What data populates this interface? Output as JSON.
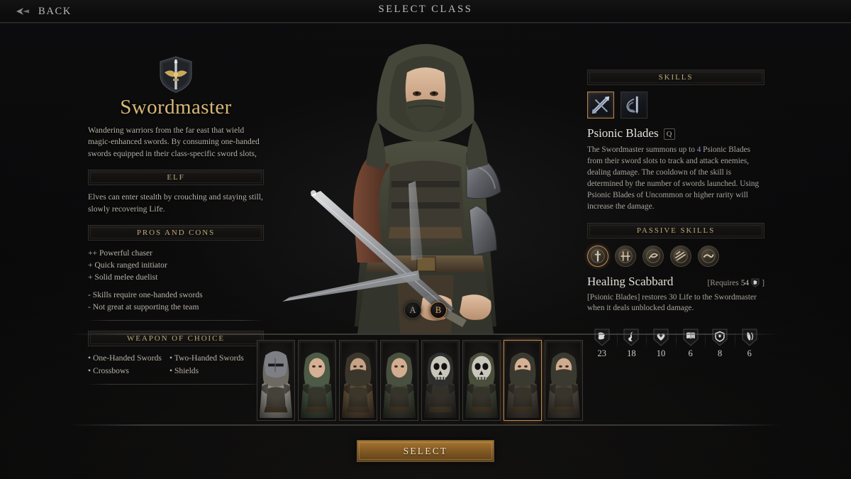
{
  "topbar": {
    "back_label": "BACK",
    "back_icon": "back-arrow-icon",
    "title": "SELECT CLASS"
  },
  "left_panel": {
    "crest_icon": "class-crest-shield-sword-icon",
    "class_name": "Swordmaster",
    "class_description": "Wandering warriors from the far east that wield magic-enhanced swords. By consuming one-handed swords equipped in their class-specific sword slots,",
    "race_section": {
      "header": "ELF",
      "description": "Elves can enter stealth by crouching and staying still, slowly recovering Life."
    },
    "pros_cons_section": {
      "header": "PROS AND CONS",
      "pros": [
        "++ Powerful chaser",
        "+ Quick ranged initiator",
        "+ Solid melee duelist"
      ],
      "cons": [
        "- Skills require one-handed swords",
        "- Not great at supporting the team"
      ]
    },
    "weapon_section": {
      "header": "WEAPON OF CHOICE",
      "items": [
        "• One-Handed Swords",
        "• Two-Handed Swords",
        "• Crossbows",
        "• Shields"
      ]
    }
  },
  "character": {
    "variants": [
      {
        "label": "A",
        "selected": false
      },
      {
        "label": "B",
        "selected": true
      }
    ]
  },
  "right_panel": {
    "skills_section": {
      "header": "SKILLS",
      "icons": [
        {
          "name": "psionic-blades-skill-icon",
          "selected": true
        },
        {
          "name": "sword-dance-skill-icon",
          "selected": false
        }
      ],
      "selected_skill": {
        "name": "Psionic Blades",
        "hotkey": "Q",
        "description_part1": "The Swordmaster summons up to ",
        "highlight": "4",
        "description_part2": " Psionic Blades from their sword slots to track and attack enemies, dealing damage. The cooldown of the skill is determined by the number of swords launched. Using Psionic Blades of Uncommon or higher rarity will increase the damage."
      }
    },
    "passive_section": {
      "header": "PASSIVE SKILLS",
      "icons": [
        {
          "name": "healing-scabbard-passive-icon",
          "selected": true
        },
        {
          "name": "passive-icon-2",
          "selected": false
        },
        {
          "name": "passive-icon-3",
          "selected": false
        },
        {
          "name": "passive-icon-4",
          "selected": false
        },
        {
          "name": "passive-icon-5",
          "selected": false
        }
      ],
      "selected_passive": {
        "name": "Healing Scabbard",
        "requires_prefix": "[Requires",
        "requires_value": "54",
        "requires_icon": "strength-icon",
        "requires_suffix": "]",
        "description": "[Psionic Blades] restores 30 Life to the Swordmaster when it deals unblocked damage."
      }
    },
    "stats": [
      {
        "icon": "strength-stat-icon",
        "value": "23"
      },
      {
        "icon": "agility-stat-icon",
        "value": "18"
      },
      {
        "icon": "vitality-stat-icon",
        "value": "10"
      },
      {
        "icon": "knowledge-stat-icon",
        "value": "6"
      },
      {
        "icon": "resourcefulness-stat-icon",
        "value": "8"
      },
      {
        "icon": "dexterity-stat-icon",
        "value": "6"
      }
    ]
  },
  "portraits": [
    {
      "name": "portrait-fighter",
      "selected": false,
      "hood": "#6c6a63",
      "cloth": "#8c8a83",
      "skin": "#c9a98e",
      "masked": false,
      "skull": false,
      "helm": true
    },
    {
      "name": "portrait-ranger",
      "selected": false,
      "hood": "#4d5b46",
      "cloth": "#3f4c3b",
      "skin": "#d6b094",
      "masked": false,
      "skull": false,
      "helm": false
    },
    {
      "name": "portrait-rogue",
      "selected": false,
      "hood": "#3b362c",
      "cloth": "#5a4a35",
      "skin": "#c6a286",
      "masked": true,
      "skull": false,
      "helm": false
    },
    {
      "name": "portrait-cleric",
      "selected": false,
      "hood": "#49503f",
      "cloth": "#3d4335",
      "skin": "#d2ad90",
      "masked": false,
      "skull": false,
      "helm": false
    },
    {
      "name": "portrait-wizard",
      "selected": false,
      "hood": "#2e2e2c",
      "cloth": "#35332e",
      "skin": "#b9b5ac",
      "masked": false,
      "skull": true,
      "helm": false
    },
    {
      "name": "portrait-warlock",
      "selected": false,
      "hood": "#4a4f3c",
      "cloth": "#3c4034",
      "skin": "#b4b0a6",
      "masked": false,
      "skull": true,
      "helm": false
    },
    {
      "name": "portrait-swordmaster",
      "selected": true,
      "hood": "#3b3a31",
      "cloth": "#47413a",
      "skin": "#d6b095",
      "masked": true,
      "skull": false,
      "helm": false
    },
    {
      "name": "portrait-druid",
      "selected": false,
      "hood": "#3b3a31",
      "cloth": "#4a443b",
      "skin": "#cfab8f",
      "masked": true,
      "skull": false,
      "helm": false
    }
  ],
  "footer": {
    "select_label": "SELECT"
  },
  "colors": {
    "accent_gold": "#d9b877",
    "accent_orange": "#c08a4d",
    "header_gold": "#bda876",
    "body_text": "#b6b1a7",
    "bg_dark": "#0a0a0b"
  }
}
